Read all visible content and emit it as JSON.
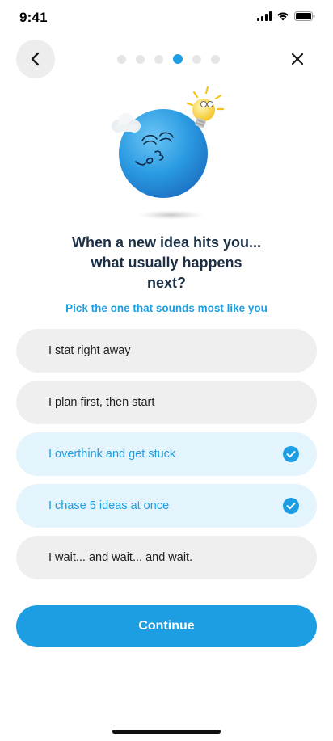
{
  "status_bar": {
    "time": "9:41",
    "icons": [
      "cellular-signal-icon",
      "wifi-icon",
      "battery-icon"
    ]
  },
  "header": {
    "back_icon": "chevron-left-icon",
    "close_icon": "close-icon",
    "progress": {
      "total_steps": 6,
      "current_step": 4
    }
  },
  "mascot": {
    "icon": "blue-ball-mascot-lightbulb-cloud"
  },
  "question": {
    "lines": [
      "When a new idea hits you...",
      "what usually happens",
      "next?"
    ]
  },
  "hint": "Pick the one that sounds most like you",
  "options": [
    {
      "label": "I stat right away",
      "selected": false
    },
    {
      "label": "I plan first, then start",
      "selected": false
    },
    {
      "label": "I overthink and get stuck",
      "selected": true
    },
    {
      "label": "I chase 5 ideas at once",
      "selected": true
    },
    {
      "label": "I wait... and wait... and wait.",
      "selected": false
    }
  ],
  "continue_label": "Continue",
  "colors": {
    "accent": "#1e9ee2",
    "selected_bg": "#e3f4fc",
    "option_bg": "#efefef",
    "title": "#1b2f45"
  }
}
